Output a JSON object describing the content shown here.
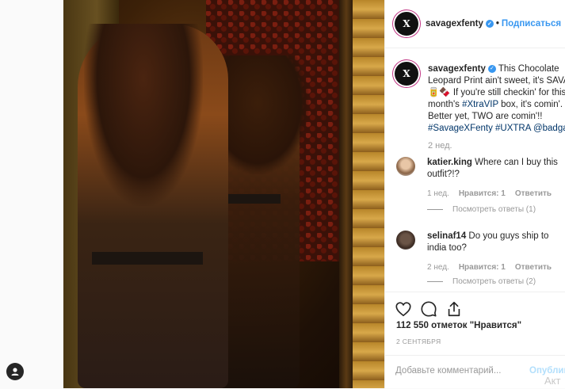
{
  "post": {
    "username": "savagexfenty",
    "follow_label": "Подписаться",
    "avatar_logo": "X",
    "caption": {
      "username": "savagexfenty",
      "line1": "This Chocolate",
      "line2": "Leopard Print ain't sweet, it's SAVAGE",
      "line3": "🥫🍫 If you're still checkin' for this",
      "line4a": "month's ",
      "line4_tag": "#XtraVIP",
      "line4b": " box, it's comin'.",
      "line5": "Better yet, TWO are comin'!!",
      "line6_tags": "#SavageXFenty #UXTRA @badgalriri"
    },
    "caption_time": "2 нед."
  },
  "comments": [
    {
      "username": "katier.king",
      "text_line1": " Where can I buy this",
      "text_line2": "outfit?!?",
      "time": "1 нед.",
      "likes": "Нравится: 1",
      "reply": "Ответить",
      "view_replies": "Посмотреть ответы (1)"
    },
    {
      "username": "selinaf14",
      "text_line1": " Do you guys ship to",
      "text_line2": "india too?",
      "time": "2 нед.",
      "likes": "Нравится: 1",
      "reply": "Ответить",
      "view_replies": "Посмотреть ответы (2)"
    }
  ],
  "actions": {
    "like_icon": "heart-icon",
    "comment_icon": "comment-icon",
    "share_icon": "share-icon"
  },
  "likes_text": "112 550 отметок \"Нравится\"",
  "date": "2 СЕНТЯБРЯ",
  "add_comment": {
    "placeholder": "Добавьте комментарий...",
    "publish_label": "Опублик"
  },
  "watermark": "Акт",
  "colors": {
    "link": "#3897f0",
    "hashtag": "#003569",
    "muted": "#999999"
  }
}
